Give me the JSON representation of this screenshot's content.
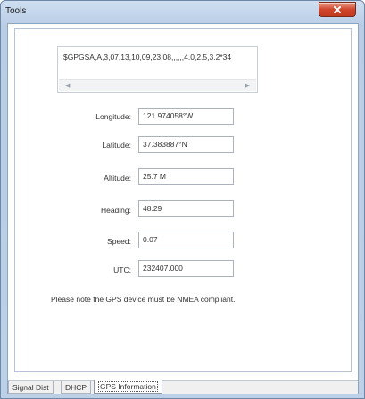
{
  "window": {
    "title": "Tools",
    "close_icon": "close-icon"
  },
  "gps": {
    "nmea_sentence": "$GPGSA,A,3,07,13,10,09,23,08,,,,,,4.0,2.5,3.2*34",
    "fields": [
      {
        "key": "longitude",
        "label": "Longitude:",
        "value": "121.974058°W"
      },
      {
        "key": "latitude",
        "label": "Latitude:",
        "value": "37.383887°N"
      },
      {
        "key": "altitude",
        "label": "Altitude:",
        "value": "25.7 M"
      },
      {
        "key": "heading",
        "label": "Heading:",
        "value": "48.29"
      },
      {
        "key": "speed",
        "label": "Speed:",
        "value": "0.07"
      },
      {
        "key": "utc",
        "label": "UTC:",
        "value": "232407.000"
      }
    ],
    "note": "Please note the GPS  device must be NMEA compliant."
  },
  "tabs": [
    {
      "label": "Signal Dist",
      "active": false
    },
    {
      "label": "DHCP",
      "active": false
    },
    {
      "label": "GPS Information",
      "active": true
    }
  ],
  "colors": {
    "close_button": "#d0462d",
    "titlebar": "#cfdff1"
  }
}
